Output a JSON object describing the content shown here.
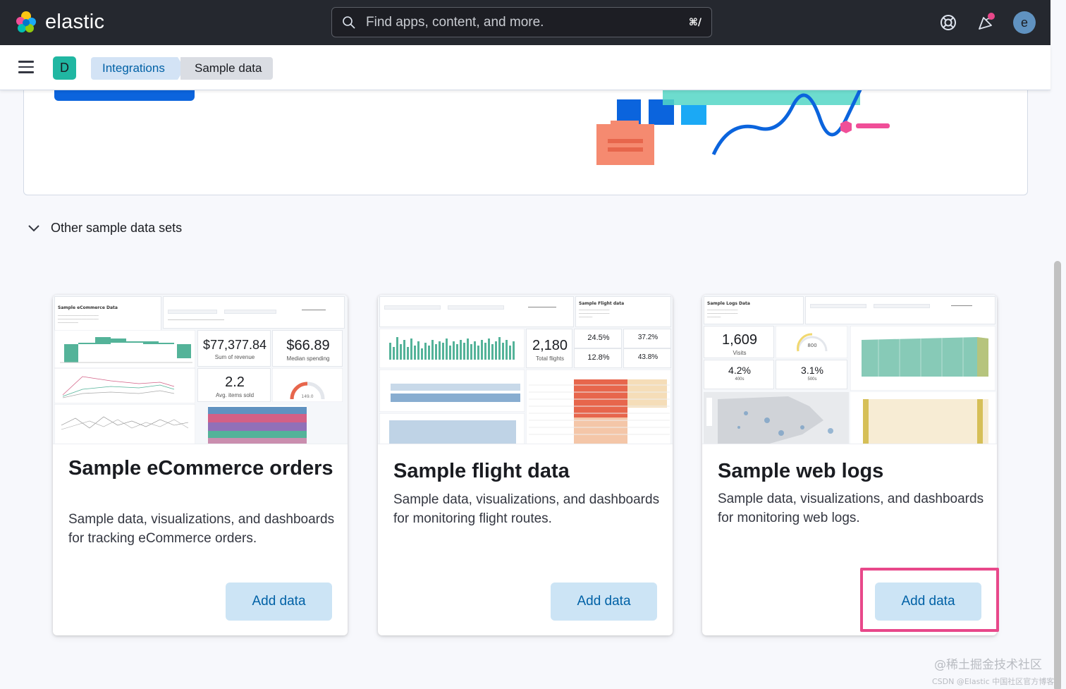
{
  "header": {
    "brand": "elastic",
    "search_placeholder": "Find apps, content, and more.",
    "search_shortcut": "⌘/",
    "avatar_letter": "e"
  },
  "breadcrumbs": {
    "space_letter": "D",
    "items": [
      "Integrations",
      "Sample data"
    ]
  },
  "accordion": {
    "label": "Other sample data sets"
  },
  "cards": [
    {
      "title": "Sample eCommerce orders",
      "description": "Sample data, visualizations, and dashboards for tracking eCommerce orders.",
      "button": "Add data",
      "preview": {
        "title": "Sample eCommerce Data",
        "metric1": "$77,377.84",
        "metric1_sub": "Sum of revenue",
        "metric2": "$66.89",
        "metric2_sub": "Median spending",
        "metric3": "2.2",
        "metric3_sub": "Avg. items sold",
        "gauge": "149.0"
      }
    },
    {
      "title": "Sample flight data",
      "description": "Sample data, visualizations, and dashboards for monitoring flight routes.",
      "button": "Add data",
      "preview": {
        "title": "Sample Flight data",
        "metric1": "2,180",
        "metric1_sub": "Total flights",
        "p1": "24.5%",
        "p2": "37.2%",
        "p3": "12.8%",
        "p4": "43.8%"
      }
    },
    {
      "title": "Sample web logs",
      "description": "Sample data, visualizations, and dashboards for monitoring web logs.",
      "button": "Add data",
      "preview": {
        "title": "Sample Logs Data",
        "metric1": "1,609",
        "metric1_sub": "Visits",
        "gauge": "800",
        "p1": "4.2%",
        "p1_sub": "400s",
        "p2": "3.1%",
        "p2_sub": "500s"
      }
    }
  ],
  "watermark": {
    "line1": "@稀土掘金技术社区",
    "line2": "CSDN @Elastic 中国社区官方博客"
  },
  "colors": {
    "header_bg": "#25282f",
    "primary": "#0b64dd",
    "button_bg": "#cce4f5",
    "button_text": "#0061a6",
    "highlight": "#e8488a",
    "space_badge": "#20b7a2"
  }
}
